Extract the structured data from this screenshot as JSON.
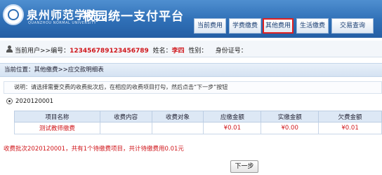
{
  "header": {
    "school_name": "泉州师范学院",
    "school_name_en": "QUANZHOU NORMAL UNIVERSITY",
    "platform_title": "校园统一支付平台",
    "nav": [
      {
        "label": "当前费用",
        "active": false
      },
      {
        "label": "学费缴费",
        "active": false
      },
      {
        "label": "其他费用",
        "active": true
      },
      {
        "label": "生活缴费",
        "active": false
      },
      {
        "label": "交易查询",
        "active": false
      }
    ]
  },
  "user": {
    "prefix": "当前用户>>编号：",
    "id": "123456789123456789",
    "name_label": "姓名：",
    "name": "李四",
    "gender_label": "性别：",
    "idcard_label": "身份证号："
  },
  "breadcrumb": "当前位置：其他缴费>>应交款明细表",
  "note": "说明：请选择需要交费的收费批次后，在相应的收费项目打勾，然后点击“下一步”按钮",
  "batch": {
    "label": "2020120001",
    "selected": true
  },
  "table": {
    "headers": [
      "项目名称",
      "收费内容",
      "收费对象",
      "应缴金额",
      "实缴金额",
      "欠费金额"
    ],
    "rows": [
      [
        "测试教师缴费",
        "",
        "",
        "¥0.01",
        "¥0.00",
        "¥0.01"
      ]
    ]
  },
  "summary": "收费批次2020120001，共有1个待缴费项目，共计待缴费用0.01元",
  "next_button": "下一步",
  "colors": {
    "header_blue": "#2f6fb6",
    "active_outline": "#e02020",
    "warning_red": "#d0161b"
  }
}
